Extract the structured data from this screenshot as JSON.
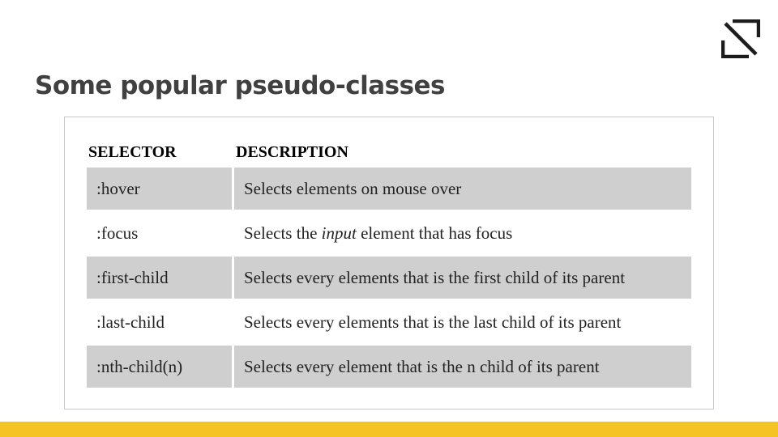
{
  "slide": {
    "title": "Some popular pseudo-classes",
    "logo_icon": "n-slash-logo-icon"
  },
  "table": {
    "headers": {
      "selector": "SELECTOR",
      "description": "DESCRIPTION"
    },
    "rows": [
      {
        "selector": ":hover",
        "desc_before": "Selects elements on mouse over",
        "desc_em": "",
        "desc_after": ""
      },
      {
        "selector": ":focus",
        "desc_before": "Selects the ",
        "desc_em": "input",
        "desc_after": " element that has focus"
      },
      {
        "selector": ":first-child",
        "desc_before": "Selects every elements that is the first child of its parent",
        "desc_em": "",
        "desc_after": ""
      },
      {
        "selector": ":last-child",
        "desc_before": "Selects every elements that is the last child of its parent",
        "desc_em": "",
        "desc_after": ""
      },
      {
        "selector": ":nth-child(n)",
        "desc_before": "Selects every element that is the n child of its parent",
        "desc_em": "",
        "desc_after": ""
      }
    ]
  },
  "colors": {
    "accent_bar": "#f6c324",
    "row_shade": "#cfcfcf",
    "title_text": "#404040"
  }
}
